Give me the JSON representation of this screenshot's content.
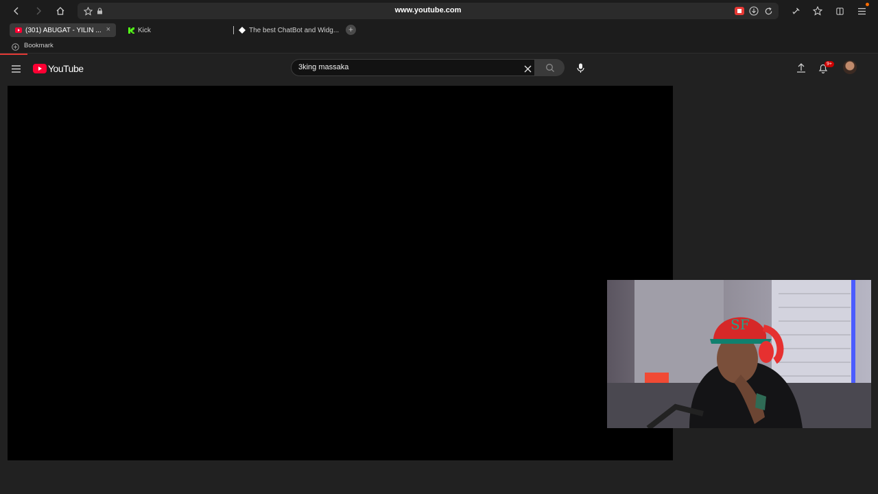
{
  "browser": {
    "url": "www.youtube.com",
    "tabs": [
      {
        "label": "(301) ABUGAT - YILIN ...",
        "close": "×",
        "active": true
      },
      {
        "label": "Kick",
        "active": false
      },
      {
        "label": "The best ChatBot and Widg...",
        "active": false
      }
    ],
    "new_tab": "+",
    "bookmark_label": "Bookmark",
    "accent": "#e53935"
  },
  "youtube": {
    "logo_text": "YouTube",
    "search": {
      "value": "3king massaka"
    },
    "notifications_badge": "9+",
    "brand_color": "#ff0033"
  },
  "icons": [
    "back-icon",
    "forward-icon",
    "home-icon",
    "star-icon",
    "lock-icon",
    "youtube-ext-icon",
    "download-icon",
    "reload-icon",
    "extensions-icon",
    "favorites-icon",
    "collections-icon",
    "menu-icon",
    "hamburger-icon",
    "clear-icon",
    "search-icon",
    "mic-icon",
    "upload-icon",
    "bell-icon",
    "avatar"
  ]
}
